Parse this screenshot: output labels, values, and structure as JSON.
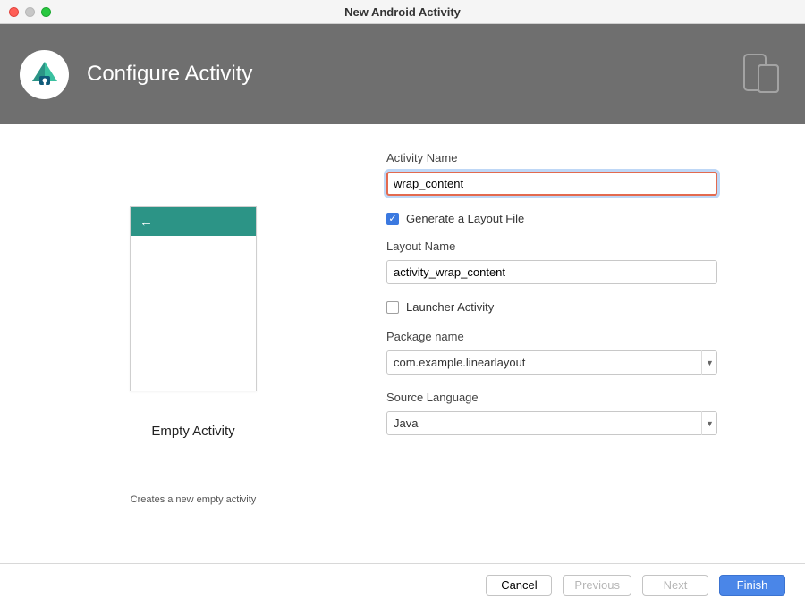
{
  "window": {
    "title": "New Android Activity"
  },
  "header": {
    "title": "Configure Activity"
  },
  "preview": {
    "title": "Empty Activity",
    "description": "Creates a new empty activity"
  },
  "form": {
    "activity_name": {
      "label": "Activity Name",
      "value": "wrap_content"
    },
    "generate_layout": {
      "label": "Generate a Layout File",
      "checked": true
    },
    "layout_name": {
      "label": "Layout Name",
      "value": "activity_wrap_content"
    },
    "launcher_activity": {
      "label": "Launcher Activity",
      "checked": false
    },
    "package_name": {
      "label": "Package name",
      "value": "com.example.linearlayout"
    },
    "source_language": {
      "label": "Source Language",
      "value": "Java"
    }
  },
  "footer": {
    "cancel": "Cancel",
    "previous": "Previous",
    "next": "Next",
    "finish": "Finish"
  }
}
